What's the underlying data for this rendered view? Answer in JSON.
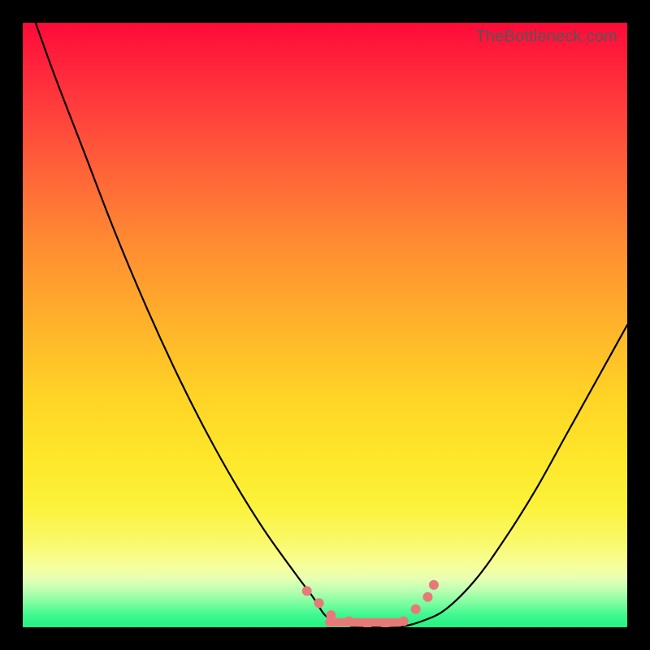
{
  "watermark": "TheBottleneck.com",
  "colors": {
    "frame": "#000000",
    "curve": "#000000",
    "marker": "#e77a79",
    "gradient_top": "#ff0a3a",
    "gradient_bottom": "#22f282"
  },
  "chart_data": {
    "type": "line",
    "title": "",
    "xlabel": "",
    "ylabel": "",
    "xlim": [
      0,
      100
    ],
    "ylim": [
      0,
      100
    ],
    "grid": false,
    "legend": false,
    "series": [
      {
        "name": "bottleneck-curve",
        "x": [
          0,
          5,
          10,
          15,
          20,
          25,
          30,
          35,
          40,
          45,
          48,
          50,
          52,
          55,
          58,
          62,
          66,
          70,
          75,
          80,
          85,
          90,
          95,
          100
        ],
        "y": [
          106,
          92,
          79,
          66,
          54,
          43,
          33,
          24,
          16,
          9,
          5,
          2,
          1,
          0,
          0,
          0,
          1,
          3,
          8,
          15,
          23,
          32,
          41,
          50
        ]
      }
    ],
    "markers": {
      "name": "highlight-dots",
      "x": [
        47,
        49,
        51,
        54,
        57,
        60,
        63,
        65,
        67,
        68
      ],
      "y": [
        6,
        4,
        2,
        1,
        0.5,
        0.5,
        1,
        3,
        5,
        7
      ]
    },
    "flat_bar": {
      "x_start": 50,
      "x_end": 63,
      "y": 0.8,
      "thickness_pct": 1.4
    }
  }
}
